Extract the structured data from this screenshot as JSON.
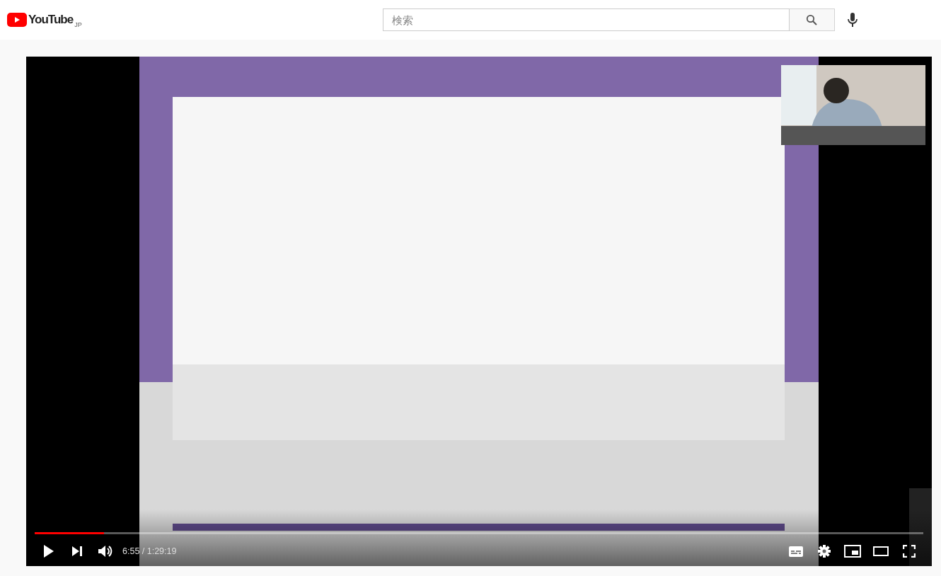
{
  "header": {
    "logo_text": "YouTube",
    "region": "JP",
    "search": {
      "placeholder": "検索"
    }
  },
  "player": {
    "progress": {
      "level": 0.078
    },
    "time": "6:55 / 1:29:19"
  }
}
